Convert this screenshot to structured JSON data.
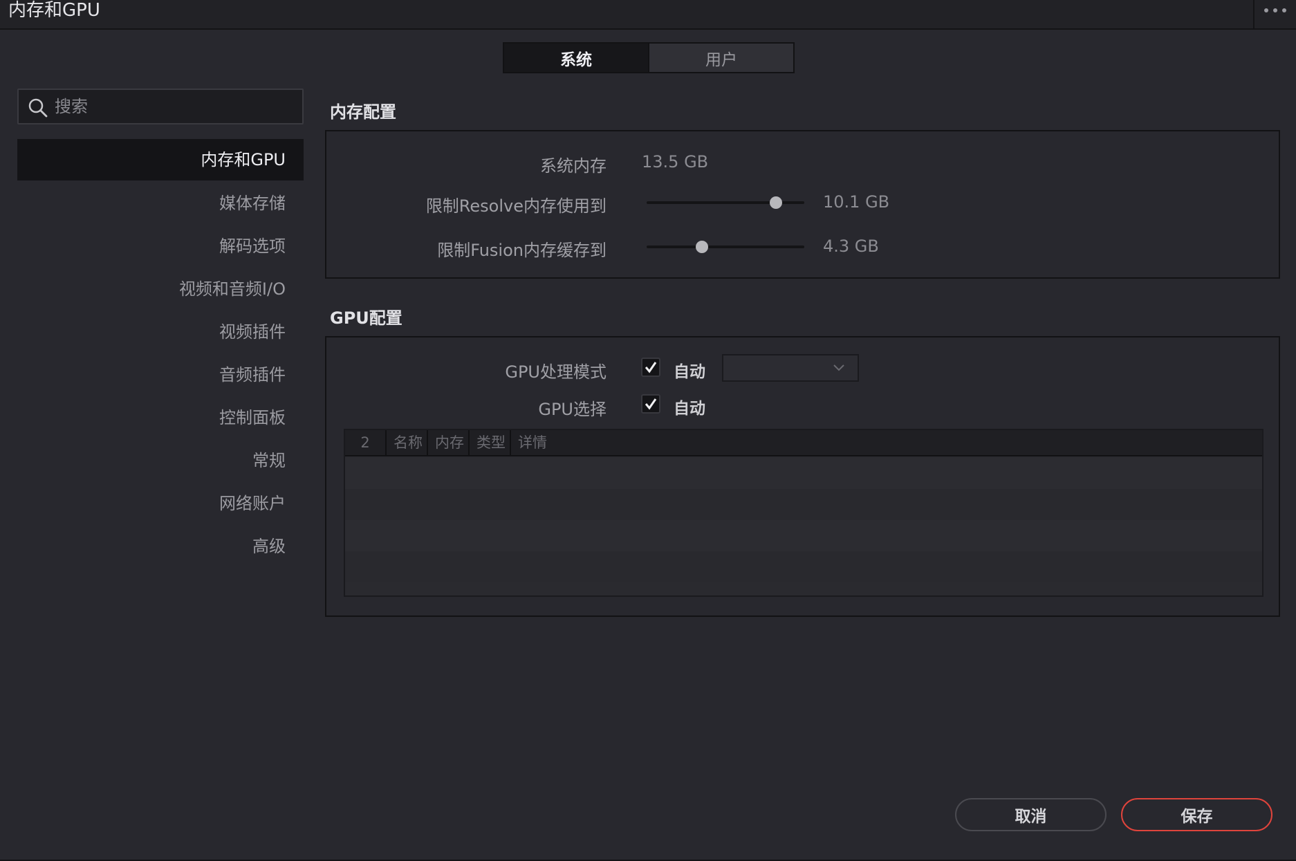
{
  "window": {
    "title": "内存和GPU"
  },
  "tabs": [
    {
      "label": "系统",
      "active": true
    },
    {
      "label": "用户",
      "active": false
    }
  ],
  "search": {
    "placeholder": "搜索",
    "value": ""
  },
  "sidebar": {
    "items": [
      {
        "label": "内存和GPU",
        "active": true
      },
      {
        "label": "媒体存储"
      },
      {
        "label": "解码选项"
      },
      {
        "label": "视频和音频I/O"
      },
      {
        "label": "视频插件"
      },
      {
        "label": "音频插件"
      },
      {
        "label": "控制面板"
      },
      {
        "label": "常规"
      },
      {
        "label": "网络账户"
      },
      {
        "label": "高级"
      }
    ]
  },
  "memory": {
    "title": "内存配置",
    "system_memory_label": "系统内存",
    "system_memory_value": "13.5 GB",
    "resolve_limit_label": "限制Resolve内存使用到",
    "resolve_limit_value": "10.1 GB",
    "resolve_limit_fraction": 0.82,
    "fusion_limit_label": "限制Fusion内存缓存到",
    "fusion_limit_value": "4.3 GB",
    "fusion_limit_fraction": 0.35
  },
  "gpu": {
    "title": "GPU配置",
    "processing_mode_label": "GPU处理模式",
    "processing_mode_auto": "自动",
    "processing_mode_checked": true,
    "processing_mode_dropdown": "",
    "selection_label": "GPU选择",
    "selection_auto": "自动",
    "selection_checked": true,
    "table": {
      "columns": [
        "2",
        "名称",
        "内存",
        "类型",
        "详情"
      ],
      "rows": [
        [],
        [],
        [],
        []
      ]
    }
  },
  "footer": {
    "cancel_label": "取消",
    "save_label": "保存",
    "accent_color": "#e0443c"
  }
}
